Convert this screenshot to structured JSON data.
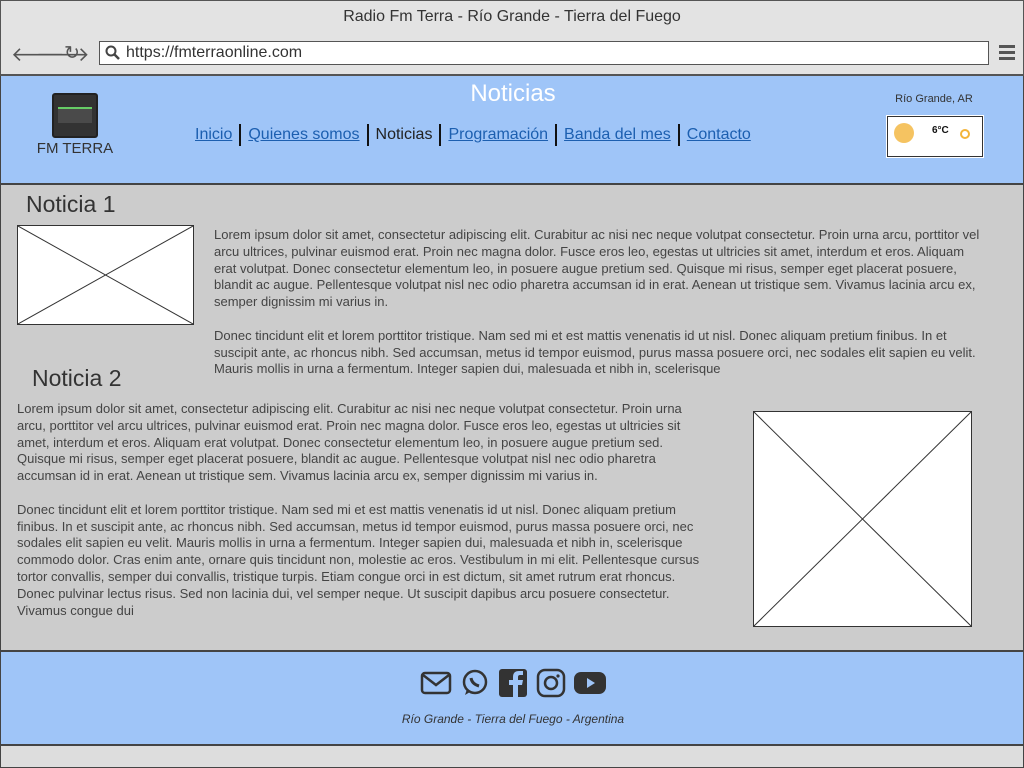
{
  "browser": {
    "title": "Radio Fm Terra - Río Grande - Tierra del Fuego",
    "url": "https://fmterraonline.com"
  },
  "header": {
    "logo_label": "FM TERRA",
    "page_title": "Noticias",
    "location": "Río Grande, AR",
    "weather_temp": "6°C",
    "nav": [
      {
        "label": "Inicio"
      },
      {
        "label": "Quienes somos"
      },
      {
        "label": "Noticias"
      },
      {
        "label": "Programación"
      },
      {
        "label": "Banda del mes"
      },
      {
        "label": "Contacto"
      }
    ]
  },
  "news": [
    {
      "title": "Noticia 1",
      "p1": "Lorem ipsum dolor sit amet, consectetur adipiscing elit. Curabitur ac nisi nec neque volutpat consectetur. Proin urna arcu, porttitor vel arcu ultrices, pulvinar euismod erat. Proin nec magna dolor. Fusce eros leo, egestas ut ultricies sit amet, interdum et eros. Aliquam erat volutpat. Donec consectetur elementum leo, in posuere augue pretium sed. Quisque mi risus, semper eget placerat posuere, blandit ac augue. Pellentesque volutpat nisl nec odio pharetra accumsan id in erat. Aenean ut tristique sem. Vivamus lacinia arcu ex, semper dignissim mi varius in.",
      "p2": "Donec tincidunt elit et lorem porttitor tristique. Nam sed mi et est mattis venenatis id ut nisl. Donec aliquam pretium finibus. In et suscipit ante, ac rhoncus nibh. Sed accumsan, metus id tempor euismod, purus massa posuere orci, nec sodales elit sapien eu velit. Mauris mollis in urna a fermentum. Integer sapien dui, malesuada et nibh in, scelerisque"
    },
    {
      "title": "Noticia 2",
      "p1": "Lorem ipsum dolor sit amet, consectetur adipiscing elit. Curabitur ac nisi nec neque volutpat consectetur. Proin urna arcu, porttitor vel arcu ultrices, pulvinar euismod erat. Proin nec magna dolor. Fusce eros leo, egestas ut ultricies sit amet, interdum et eros. Aliquam erat volutpat. Donec consectetur elementum leo, in posuere augue pretium sed. Quisque mi risus, semper eget placerat posuere, blandit ac augue. Pellentesque volutpat nisl nec odio pharetra accumsan id in erat. Aenean ut tristique sem. Vivamus lacinia arcu ex, semper dignissim mi varius in.",
      "p2": "Donec tincidunt elit et lorem porttitor tristique. Nam sed mi et est mattis venenatis id ut nisl. Donec aliquam pretium finibus. In et suscipit ante, ac rhoncus nibh. Sed accumsan, metus id tempor euismod, purus massa posuere orci, nec sodales elit sapien eu velit. Mauris mollis in urna a fermentum. Integer sapien dui, malesuada et nibh in, scelerisque commodo dolor. Cras enim ante, ornare quis tincidunt non, molestie ac eros. Vestibulum in mi elit. Pellentesque cursus tortor convallis, semper dui convallis, tristique turpis. Etiam congue orci in est dictum, sit amet rutrum erat rhoncus. Donec pulvinar lectus risus. Sed non lacinia dui, vel semper neque. Ut suscipit dapibus arcu posuere consectetur. Vivamus congue dui"
    }
  ],
  "footer": {
    "icons": [
      "mail-icon",
      "whatsapp-icon",
      "facebook-icon",
      "instagram-icon",
      "youtube-icon"
    ],
    "tagline": "Río Grande - Tierra del Fuego - Argentina"
  }
}
